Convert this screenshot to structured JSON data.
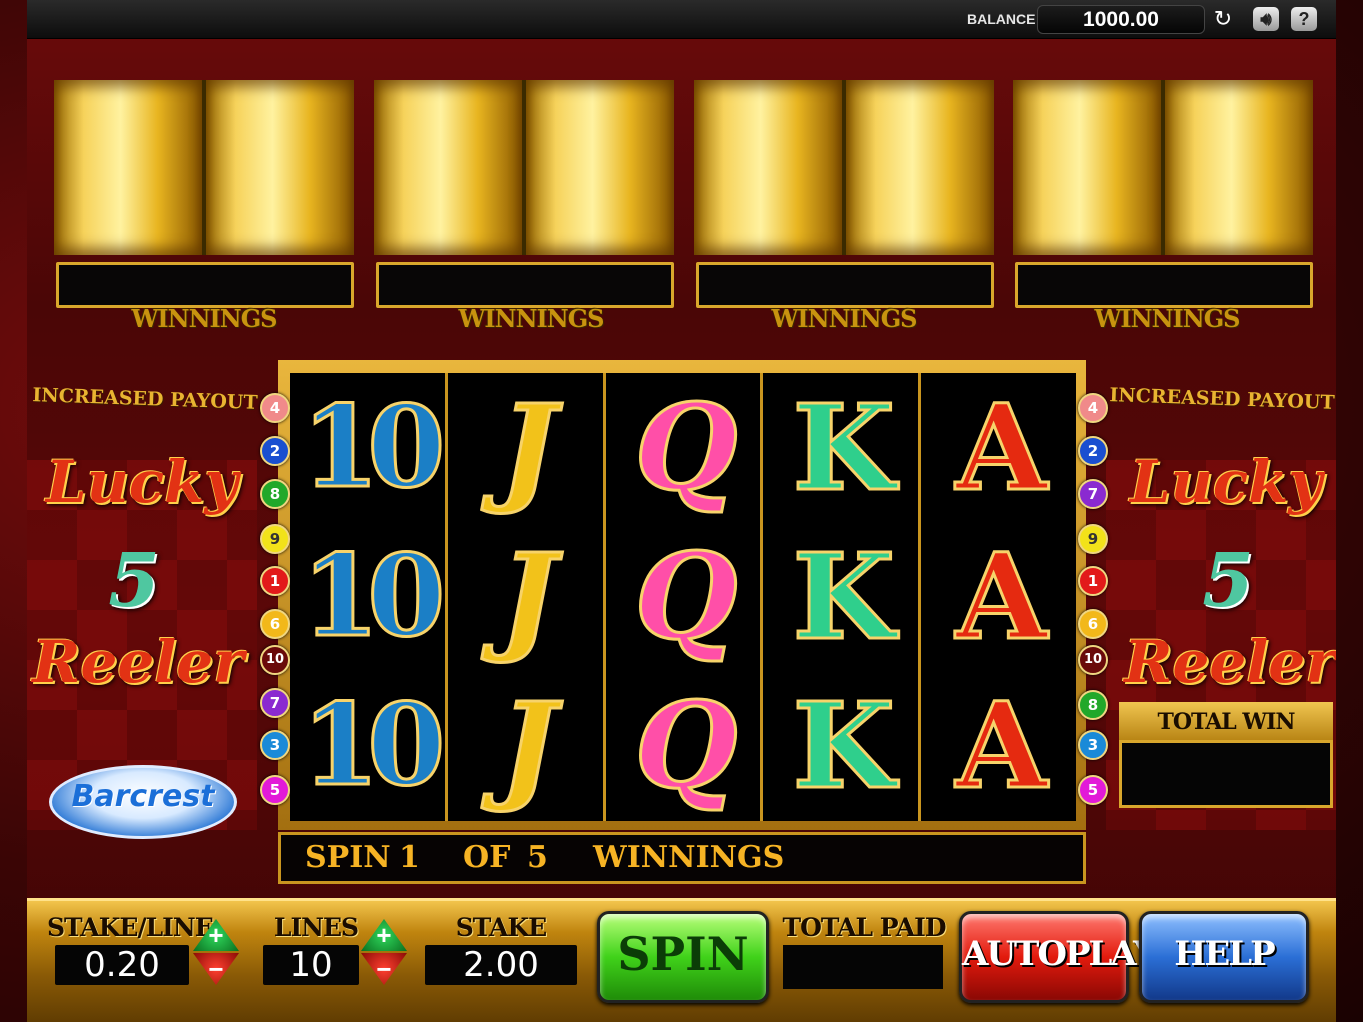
{
  "topbar": {
    "balance_label": "BALANCE",
    "balance_value": "1000.00",
    "refresh_icon": "refresh-icon",
    "sound_icon": "speaker-icon",
    "help_icon": "question-icon"
  },
  "bonus": {
    "winnings_label": "WINNINGS",
    "panels": [
      {
        "label": "WINNINGS"
      },
      {
        "label": "WINNINGS"
      },
      {
        "label": "WINNINGS"
      },
      {
        "label": "WINNINGS"
      }
    ]
  },
  "side": {
    "increased_payout": "INCREASED PAYOUT",
    "logo_line1": "Lucky",
    "logo_line2": "5",
    "logo_line3": "Reeler",
    "provider": "Barcrest",
    "total_win_label": "TOTAL WIN"
  },
  "paylines": {
    "left": [
      "4",
      "2",
      "8",
      "9",
      "1",
      "6",
      "10",
      "7",
      "3",
      "5"
    ],
    "right": [
      "4",
      "2",
      "7",
      "9",
      "1",
      "6",
      "10",
      "8",
      "3",
      "5"
    ]
  },
  "reels": [
    [
      "10",
      "10",
      "10"
    ],
    [
      "J",
      "J",
      "J"
    ],
    [
      "Q",
      "Q",
      "Q"
    ],
    [
      "K",
      "K",
      "K"
    ],
    [
      "A",
      "A",
      "A"
    ]
  ],
  "status": {
    "spin_word": "SPIN",
    "spin_number": "1",
    "of_word": "OF",
    "spin_total": "5",
    "winnings_word": "WINNINGS"
  },
  "controls": {
    "stake_line_label": "STAKE/LINE",
    "stake_line_value": "0.20",
    "lines_label": "LINES",
    "lines_value": "10",
    "stake_label": "STAKE",
    "stake_value": "2.00",
    "spin_label": "SPIN",
    "total_paid_label": "TOTAL PAID",
    "autoplay_label": "AUTOPLAY",
    "help_label": "HELP",
    "plus_symbol": "+",
    "minus_symbol": "−"
  },
  "colors": {
    "gold": "#d9a72c",
    "spin_green": "#40d21a",
    "autoplay_red": "#e21a0d",
    "help_blue": "#2b6fd6",
    "status_text": "#f6b324"
  }
}
